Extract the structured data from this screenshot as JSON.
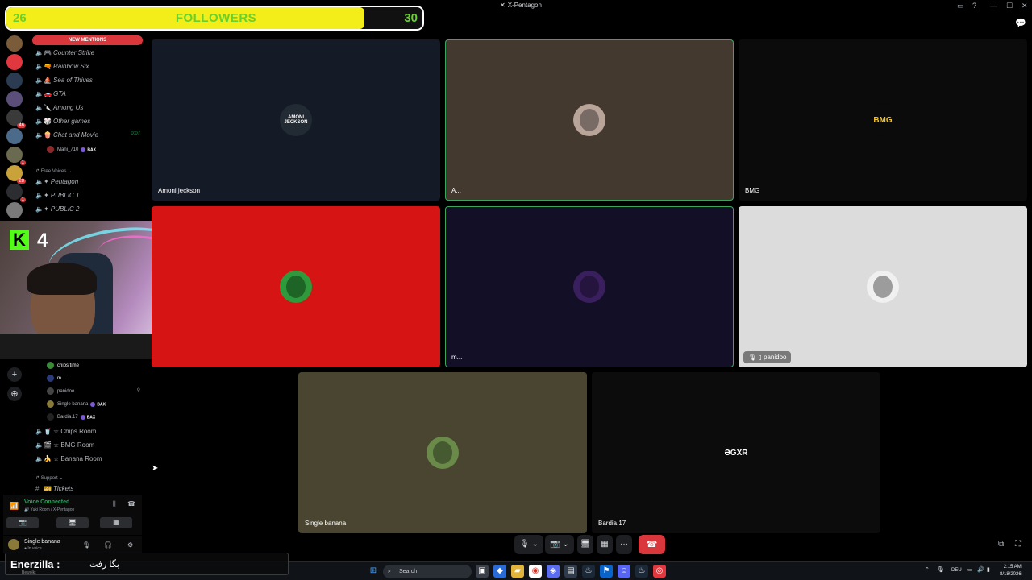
{
  "window": {
    "title": "X-Pentagon",
    "app_glyph": "✕",
    "controls": [
      "▭",
      "?",
      "—",
      "☐",
      "✕"
    ]
  },
  "followers_goal": {
    "label": "FOLLOWERS",
    "current": "26",
    "goal": "30",
    "progress_fraction": 0.86,
    "fill_color": "#f3ee1a",
    "text_color": "#69d12c"
  },
  "rail": {
    "servers": [
      {
        "name": "server-1",
        "color": "#7a5c3a",
        "badge": ""
      },
      {
        "name": "server-2",
        "color": "#e0383e",
        "badge": ""
      },
      {
        "name": "server-3",
        "color": "#2a3b52",
        "badge": ""
      },
      {
        "name": "server-4",
        "color": "#5b4f7a",
        "badge": ""
      },
      {
        "name": "server-5",
        "color": "#3a3a3a",
        "badge": "46"
      },
      {
        "name": "server-6",
        "color": "#4c6a8a",
        "badge": ""
      },
      {
        "name": "server-7",
        "color": "#6a6a50",
        "badge": "1"
      },
      {
        "name": "server-8",
        "color": "#c9a23a",
        "badge": "28"
      },
      {
        "name": "server-9",
        "color": "#2b2d31",
        "badge": "1"
      },
      {
        "name": "server-10",
        "color": "#7a7a7a",
        "badge": ""
      }
    ],
    "add_label": "+",
    "explore_label": "⊕"
  },
  "sidebar": {
    "new_mentions": "NEW MENTIONS",
    "channels": [
      {
        "emoji": "🎮",
        "name": "Counter Strike"
      },
      {
        "emoji": "🔫",
        "name": "Rainbow Six"
      },
      {
        "emoji": "⛵",
        "name": "Sea of Thives"
      },
      {
        "emoji": "🚗",
        "name": "GTA"
      },
      {
        "emoji": "🔪",
        "name": "Among Us"
      },
      {
        "emoji": "🎲",
        "name": "Other games"
      },
      {
        "emoji": "🍿",
        "name": "Chat and Movie",
        "time": "0:07"
      }
    ],
    "chat_member": {
      "name": "Mani_710",
      "tag": "BAX"
    },
    "free_voices_label": "↱ Free Voices ⌄",
    "free_voices": [
      "✦ Pentagon",
      "✦ PUBLIC 1",
      "✦ PUBLIC 2"
    ],
    "room_members": [
      {
        "name": "chips time",
        "color": "#3a8a3a",
        "white": true,
        "tag": ""
      },
      {
        "name": "m...",
        "color": "#2a3b7a",
        "white": true,
        "tag": ""
      },
      {
        "name": "panidoo",
        "color": "#444",
        "white": false,
        "tag": ""
      },
      {
        "name": "Single banana",
        "color": "#8a7a3a",
        "white": false,
        "tag": "BAX"
      },
      {
        "name": "Bardia.17",
        "color": "#222",
        "white": false,
        "tag": "BAX"
      }
    ],
    "rooms": [
      {
        "emoji": "🥤",
        "name": "☆ Chips Room"
      },
      {
        "emoji": "🎬",
        "name": "☆ BMG Room"
      },
      {
        "emoji": "🍌",
        "name": "☆ Banana Room"
      }
    ],
    "support_label": "↱ Support ⌄",
    "tickets": "Tickets"
  },
  "voice_panel": {
    "status": "Voice Connected",
    "location": "🔊 Yuki Room / X-Pentagon"
  },
  "user_panel": {
    "name": "Single banana",
    "status": "● In voice"
  },
  "webcam": {
    "platform_logo": "K",
    "viewer_count": "4"
  },
  "tiles": [
    {
      "name": "Amoni jeckson",
      "bg": "#141b26",
      "avatar_text": "AMONI JECKSON",
      "avatar_bg": "#222a33",
      "speaking": false,
      "pill": false
    },
    {
      "name": "A...",
      "bg": "#44392f",
      "avatar_text": "",
      "avatar_bg": "#b9a49a",
      "speaking": true,
      "pill": false
    },
    {
      "name": "BMG",
      "bg": "#0b0b0b",
      "avatar_text": "BMG",
      "avatar_bg": "#0b0b0b",
      "speaking": false,
      "pill": false
    },
    {
      "name": "",
      "bg": "#d61414",
      "avatar_text": "",
      "avatar_bg": "#2e9a3c",
      "speaking": false,
      "pill": false
    },
    {
      "name": "m...",
      "bg": "#130f26",
      "avatar_text": "",
      "avatar_bg": "#3a1f5e",
      "speaking": true,
      "pill": false
    },
    {
      "name": "🎙 ▯ panidoo",
      "bg": "#dcdcdc",
      "avatar_text": "",
      "avatar_bg": "#f0f0f0",
      "speaking": false,
      "pill": true
    },
    {
      "name": "Single banana",
      "bg": "#4a4530",
      "avatar_text": "",
      "avatar_bg": "#6a8a4a",
      "speaking": false,
      "pill": false
    },
    {
      "name": "Bardia.17",
      "bg": "#0c0c0c",
      "avatar_text": "ƏGXR",
      "avatar_bg": "#0c0c0c",
      "speaking": false,
      "pill": false
    }
  ],
  "call_controls": {
    "mic": "🎙",
    "camera": "📷",
    "screen_share": "🖥",
    "activity": "▦",
    "more": "···",
    "hangup": "☎"
  },
  "chat_overlay": {
    "name": "Enerzilla :",
    "message": "بگا رفت",
    "sub": "Bewolkt"
  },
  "taskbar": {
    "search": "Search",
    "lang": "DEU",
    "time": "2:15 AM",
    "date": "8/18/2026"
  }
}
